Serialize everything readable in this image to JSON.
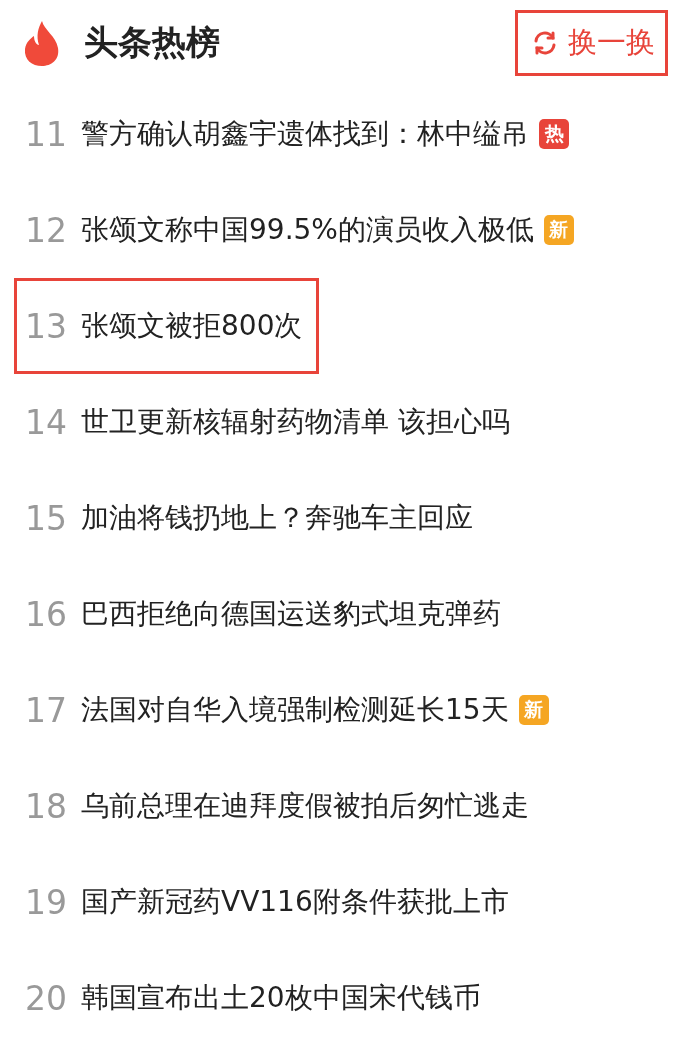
{
  "header": {
    "title": "头条热榜",
    "refresh_button": {
      "label": "换一换",
      "highlighted": true
    }
  },
  "items": [
    {
      "rank": "11",
      "title": "警方确认胡鑫宇遗体找到：林中缢吊",
      "badge": {
        "text": "热",
        "kind": "hot"
      },
      "highlighted": false
    },
    {
      "rank": "12",
      "title": "张颂文称中国99.5%的演员收入极低",
      "badge": {
        "text": "新",
        "kind": "new"
      },
      "highlighted": false
    },
    {
      "rank": "13",
      "title": "张颂文被拒800次",
      "highlighted": true
    },
    {
      "rank": "14",
      "title": "世卫更新核辐射药物清单 该担心吗",
      "highlighted": false
    },
    {
      "rank": "15",
      "title": "加油将钱扔地上？奔驰车主回应",
      "highlighted": false
    },
    {
      "rank": "16",
      "title": "巴西拒绝向德国运送豹式坦克弹药",
      "highlighted": false
    },
    {
      "rank": "17",
      "title": "法国对自华入境强制检测延长15天",
      "badge": {
        "text": "新",
        "kind": "new"
      },
      "highlighted": false
    },
    {
      "rank": "18",
      "title": "乌前总理在迪拜度假被拍后匆忙逃走",
      "highlighted": false
    },
    {
      "rank": "19",
      "title": "国产新冠药VV116附条件获批上市",
      "highlighted": false
    },
    {
      "rank": "20",
      "title": "韩国宣布出土20枚中国宋代钱币",
      "highlighted": false
    }
  ]
}
